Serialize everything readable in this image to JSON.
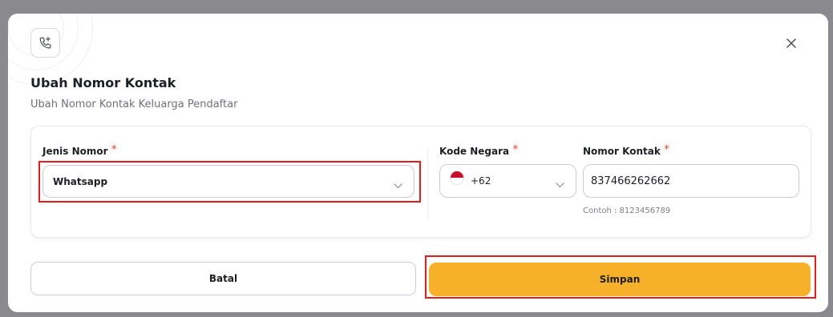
{
  "modal": {
    "title": "Ubah Nomor Kontak",
    "subtitle": "Ubah Nomor Kontak Keluarga Pendaftar",
    "header_icon": "phone-plus-icon",
    "close_icon": "close-icon"
  },
  "form": {
    "jenis_nomor": {
      "label": "Jenis Nomor",
      "required_mark": "*",
      "value": "Whatsapp"
    },
    "kode_negara": {
      "label": "Kode Negara",
      "required_mark": "*",
      "value": "+62",
      "flag_icon": "indonesia-flag-icon"
    },
    "nomor_kontak": {
      "label": "Nomor Kontak",
      "required_mark": "*",
      "value": "837466262662",
      "hint": "Contoh : 8123456789"
    }
  },
  "actions": {
    "cancel_label": "Batal",
    "save_label": "Simpan"
  },
  "colors": {
    "primary": "#f7b02a",
    "required": "#e5483b",
    "highlight": "#e11d1d",
    "backdrop": "#8a8a8e"
  }
}
